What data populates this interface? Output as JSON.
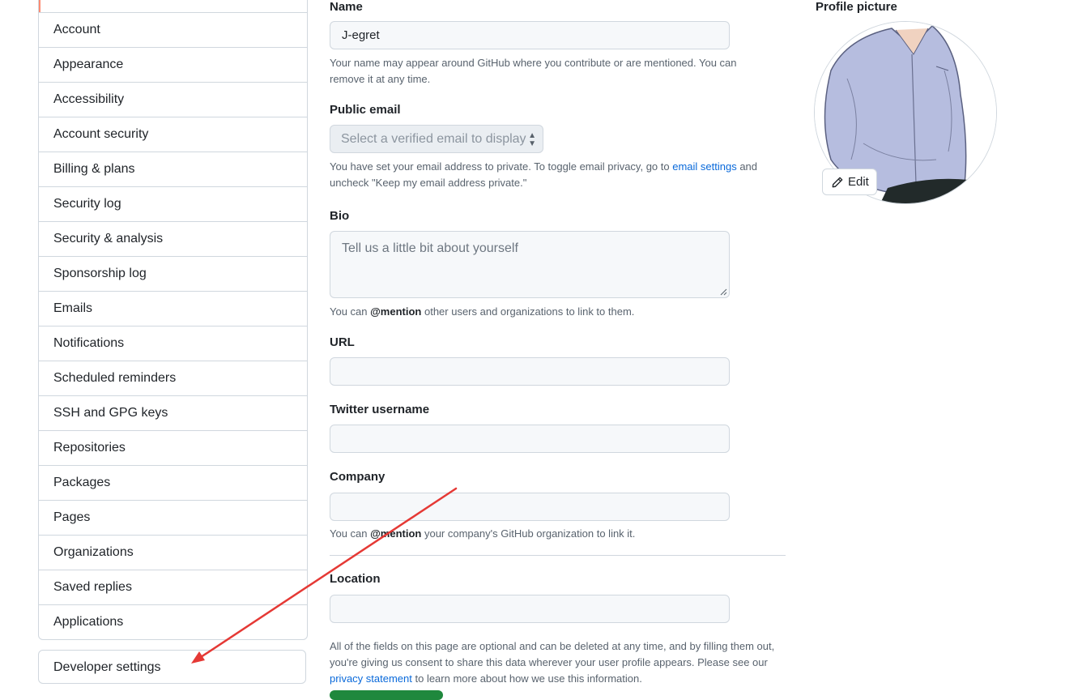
{
  "sidebar": {
    "items": [
      {
        "label": ""
      },
      {
        "label": "Account"
      },
      {
        "label": "Appearance"
      },
      {
        "label": "Accessibility"
      },
      {
        "label": "Account security"
      },
      {
        "label": "Billing & plans"
      },
      {
        "label": "Security log"
      },
      {
        "label": "Security & analysis"
      },
      {
        "label": "Sponsorship log"
      },
      {
        "label": "Emails"
      },
      {
        "label": "Notifications"
      },
      {
        "label": "Scheduled reminders"
      },
      {
        "label": "SSH and GPG keys"
      },
      {
        "label": "Repositories"
      },
      {
        "label": "Packages"
      },
      {
        "label": "Pages"
      },
      {
        "label": "Organizations"
      },
      {
        "label": "Saved replies"
      },
      {
        "label": "Applications"
      }
    ],
    "developer_settings": "Developer settings"
  },
  "form": {
    "name": {
      "label": "Name",
      "value": "J-egret",
      "note": "Your name may appear around GitHub where you contribute or are mentioned. You can remove it at any time."
    },
    "public_email": {
      "label": "Public email",
      "selected": "Select a verified email to display",
      "note_before": "You have set your email address to private. To toggle email privacy, go to ",
      "note_link": "email settings",
      "note_after": " and uncheck \"Keep my email address private.\""
    },
    "bio": {
      "label": "Bio",
      "placeholder": "Tell us a little bit about yourself",
      "note_before": "You can ",
      "note_mention": "@mention",
      "note_after": " other users and organizations to link to them."
    },
    "url": {
      "label": "URL",
      "value": ""
    },
    "twitter": {
      "label": "Twitter username",
      "value": ""
    },
    "company": {
      "label": "Company",
      "value": "",
      "note_before": "You can ",
      "note_mention": "@mention",
      "note_after": " your company's GitHub organization to link it."
    },
    "location": {
      "label": "Location",
      "value": ""
    },
    "footer": {
      "before": "All of the fields on this page are optional and can be deleted at any time, and by filling them out, you're giving us consent to share this data wherever your user profile appears. Please see our ",
      "link": "privacy statement",
      "after": " to learn more about how we use this information."
    }
  },
  "profile_picture": {
    "label": "Profile picture",
    "edit_label": "Edit"
  },
  "colors": {
    "accent_link": "#0969da",
    "sidebar_selected": "#fd8c73",
    "annotation_arrow": "#e53935",
    "primary_button": "#1f883d"
  }
}
